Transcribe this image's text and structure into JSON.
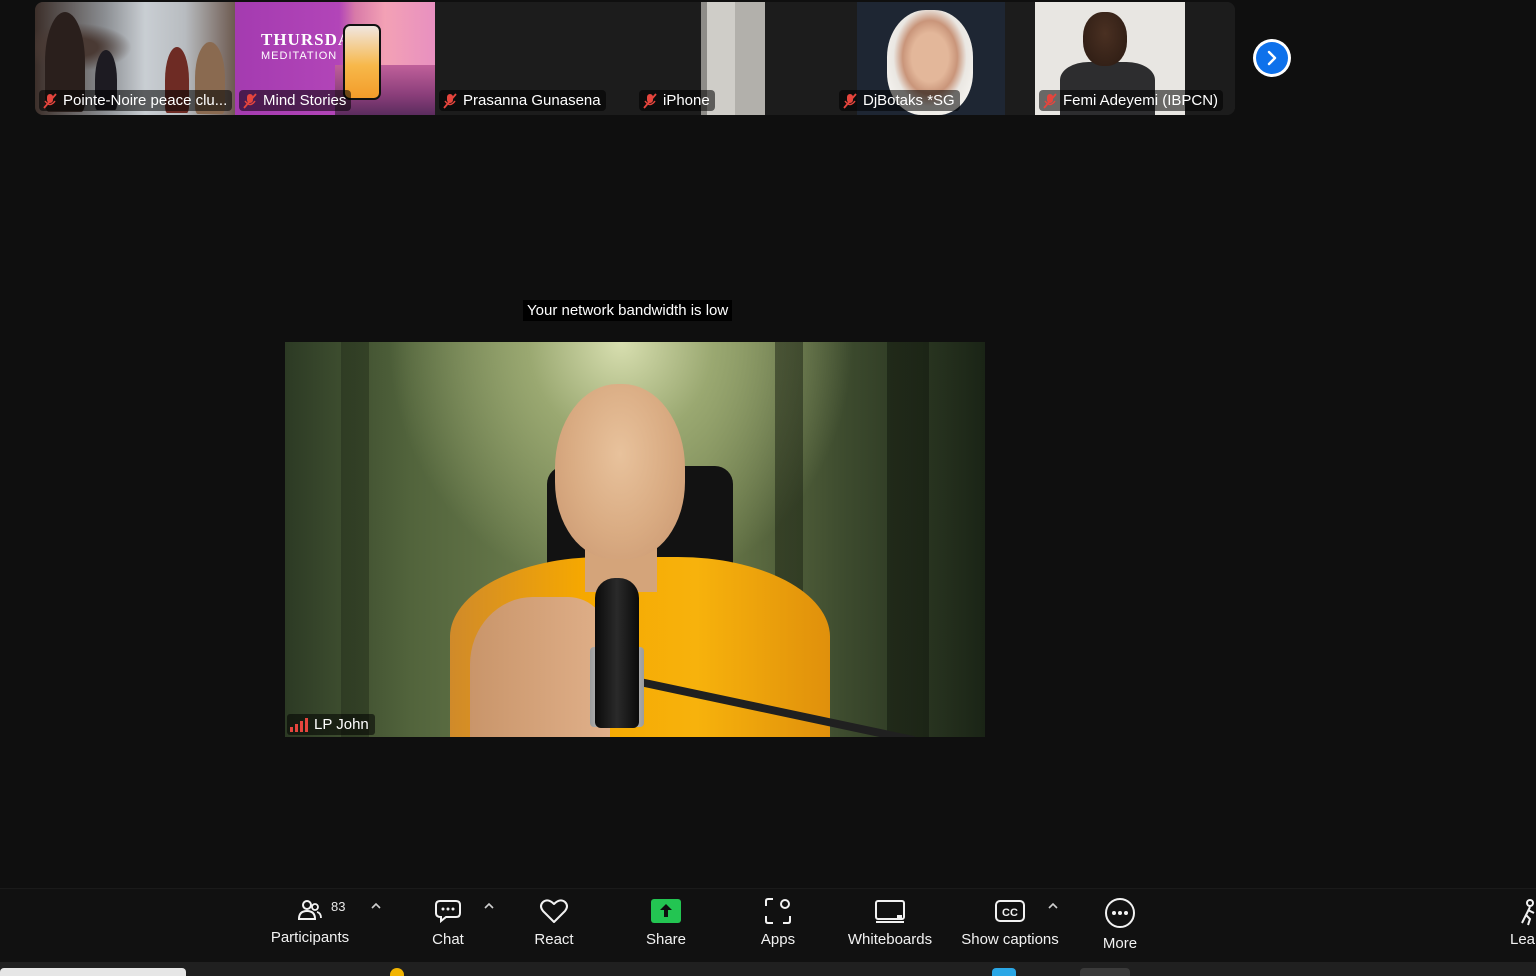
{
  "participants_strip": [
    {
      "name": "Pointe-Noire peace clu...",
      "muted": true
    },
    {
      "name": "Mind Stories",
      "muted": true,
      "promo": {
        "title": "THURSDAY",
        "subtitle": "MEDITATION"
      }
    },
    {
      "name": "Prasanna Gunasena",
      "muted": true
    },
    {
      "name": "iPhone",
      "muted": true
    },
    {
      "name": "DjBotaks *SG",
      "muted": true
    },
    {
      "name": "Femi Adeyemi (IBPCN)",
      "muted": true
    }
  ],
  "notice": "Your network bandwidth is low",
  "speaker": {
    "name": "LP John",
    "signal_bars": 4
  },
  "toolbar": {
    "participants_label": "Participants",
    "participants_count": "83",
    "chat_label": "Chat",
    "react_label": "React",
    "share_label": "Share",
    "apps_label": "Apps",
    "whiteboards_label": "Whiteboards",
    "captions_label": "Show captions",
    "captions_icon_text": "CC",
    "more_label": "More",
    "leave_label": "Lea"
  },
  "colors": {
    "accent_blue": "#0e71eb",
    "share_green": "#23c552",
    "muted_red": "#e5453d",
    "background": "#0f0f0f"
  },
  "icons": [
    "mic-off-icon",
    "chevron-right-icon",
    "participants-icon",
    "chat-icon",
    "heart-icon",
    "share-icon",
    "apps-icon",
    "whiteboard-icon",
    "captions-icon",
    "more-icon",
    "caret-up-icon",
    "leave-icon",
    "signal-icon"
  ]
}
